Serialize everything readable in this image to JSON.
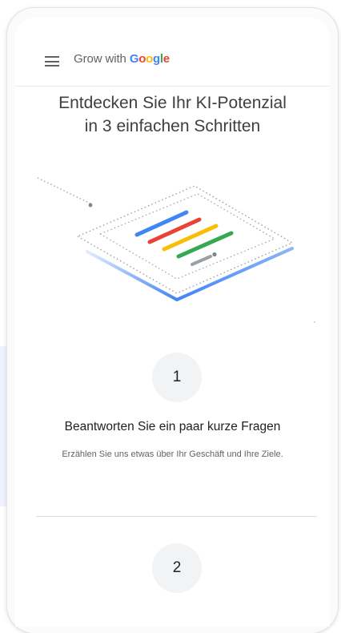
{
  "header": {
    "brand_prefix": "Grow with",
    "brand_google": [
      "G",
      "o",
      "o",
      "g",
      "l",
      "e"
    ]
  },
  "hero": {
    "title_line1": "Entdecken Sie Ihr KI-Potenzial",
    "title_line2": "in 3 einfachen Schritten"
  },
  "colors": {
    "google_blue": "#4285f4",
    "google_red": "#ea4335",
    "google_yellow": "#fbbc04",
    "google_green": "#34a853"
  },
  "steps": [
    {
      "number": "1",
      "title": "Beantworten Sie ein paar kurze Fragen",
      "description": "Erzählen Sie uns etwas über Ihr Geschäft und Ihre Ziele."
    },
    {
      "number": "2"
    }
  ]
}
